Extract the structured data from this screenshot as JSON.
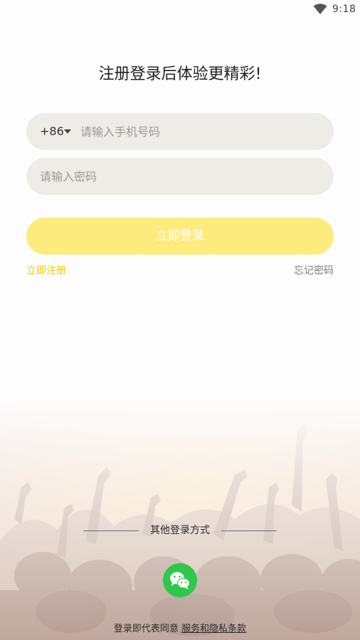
{
  "status_bar": {
    "time": "9:18",
    "wifi_icon": "wifi-icon"
  },
  "headline": "注册登录后体验更精彩!",
  "phone": {
    "country_code": "+86",
    "caret_icon": "caret-down-icon",
    "placeholder": "请输入手机号码",
    "value": ""
  },
  "password": {
    "placeholder": "请输入密码",
    "value": ""
  },
  "login_button": "立即登录",
  "register_link": "立即注册",
  "forgot_link": "忘记密码",
  "other_login": {
    "label": "其他登录方式",
    "wechat_icon": "wechat-icon"
  },
  "terms": {
    "prefix": "登录即代表同意 ",
    "link": "服务和隐私条款"
  },
  "colors": {
    "accent_yellow": "#feeb7e",
    "register_link": "#f6c900",
    "wechat_green": "#2ec84a",
    "input_bg": "#edece7"
  }
}
